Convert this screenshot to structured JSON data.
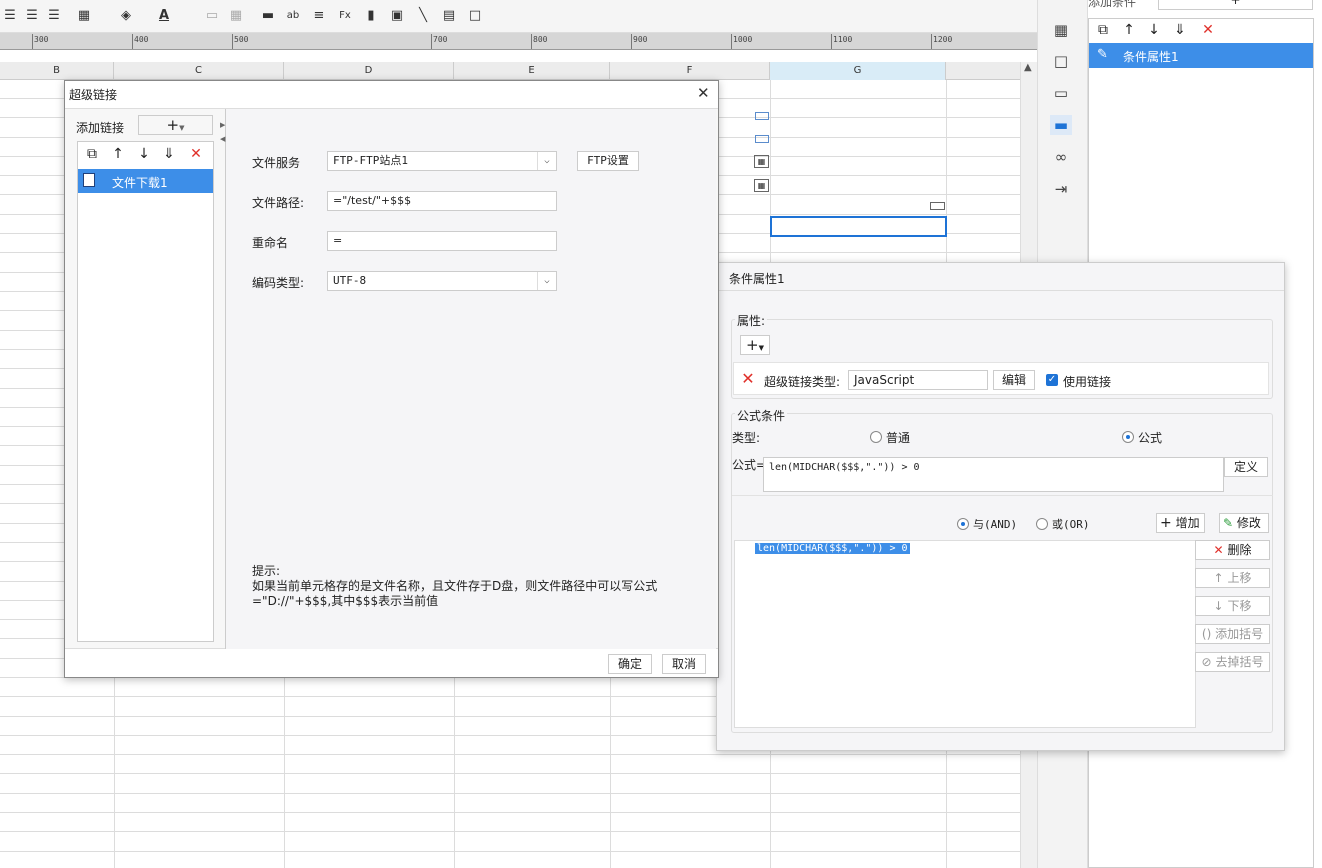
{
  "ruler": {
    "ticks": [
      "300",
      "400",
      "500",
      "700",
      "800",
      "900",
      "1000",
      "1100",
      "1200"
    ]
  },
  "columns": [
    "B",
    "C",
    "D",
    "E",
    "F",
    "G"
  ],
  "right_panel": {
    "header": "添加条件",
    "add_symbol": "+",
    "list": [
      "条件属性1"
    ]
  },
  "hyperlink_dialog": {
    "title": "超级链接",
    "add_link_label": "添加链接",
    "add_symbol": "+",
    "link_items": [
      "文件下载1"
    ],
    "file_service_label": "文件服务",
    "file_service_value": "FTP-FTP站点1",
    "ftp_settings_button": "FTP设置",
    "file_path_label": "文件路径:",
    "file_path_value": "=\"/test/\"+$$$",
    "rename_label": "重命名",
    "rename_value": "=",
    "encoding_label": "编码类型:",
    "encoding_value": "UTF-8",
    "hint_title": "提示:",
    "hint_line1": "如果当前单元格存的是文件名称，且文件存于D盘，则文件路径中可以写公式",
    "hint_line2": "=\"D://\"+$$$,其中$$$表示当前值",
    "ok_button": "确定",
    "cancel_button": "取消"
  },
  "condition_dialog": {
    "title": "条件属性1",
    "properties_label": "属性:",
    "add_symbol": "+",
    "hyperlink_type_label": "超级链接类型:",
    "hyperlink_type_value": "JavaScript",
    "edit_button": "编辑",
    "use_link_label": "使用链接",
    "formula_condition_label": "公式条件",
    "type_label": "类型:",
    "radio_normal": "普通",
    "radio_formula": "公式",
    "formula_label": "公式=",
    "formula_value": "len(MIDCHAR($$$,\".\")) > 0",
    "define_button": "定义",
    "and_label": "与(AND)",
    "or_label": "或(OR)",
    "add_button": "增加",
    "modify_button": "修改",
    "condition_item": "len(MIDCHAR($$$,\".\")) > 0",
    "delete_button": "删除",
    "move_up_button": "上移",
    "move_down_button": "下移",
    "add_bracket_button": "添加括号",
    "remove_bracket_button": "去掉括号"
  },
  "colors": {
    "accent": "#1e73d6",
    "danger": "#e0302a",
    "selection": "#3d8ee8"
  }
}
